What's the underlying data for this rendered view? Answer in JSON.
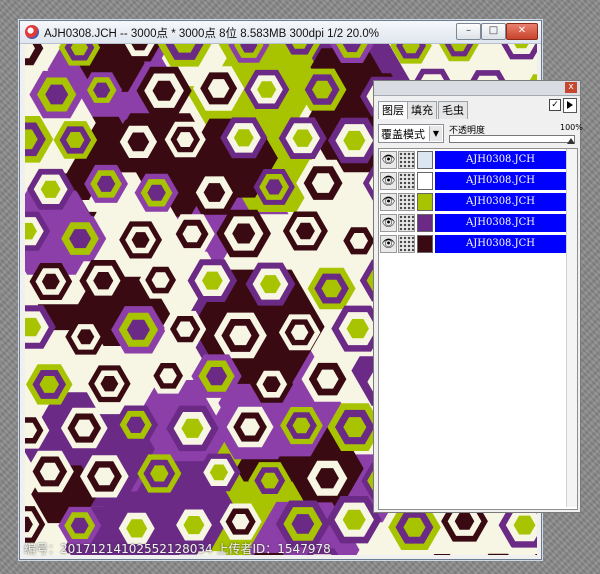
{
  "window": {
    "title": "AJH0308.JCH -- 3000点 * 3000点 8位   8.583MB 300dpi 1/2  20.0%",
    "controls": {
      "minimize": "–",
      "maximize": "□",
      "close": "✕"
    },
    "icon": "app-logo-icon"
  },
  "canvas": {
    "palette": {
      "purple": "#6b2a86",
      "lime": "#a8c400",
      "maroon": "#3a0a12",
      "cream": "#f7f6e4",
      "violet": "#8c3fa8"
    }
  },
  "layers_panel": {
    "close": "x",
    "tabs": [
      "图层",
      "填充",
      "毛虫"
    ],
    "checkbox": "✓",
    "blend_mode": "覆盖模式",
    "blend_arrow": "▼",
    "opacity_label": "不透明度",
    "opacity_value": "100%",
    "opacity": 1.0,
    "layers": [
      {
        "name": "AJH0308.JCH",
        "color": "#dce6f0",
        "eye": "👁"
      },
      {
        "name": "AJH0308.JCH",
        "color": "#ffffff",
        "eye": "👁"
      },
      {
        "name": "AJH0308.JCH",
        "color": "#a8c400",
        "eye": "👁"
      },
      {
        "name": "AJH0308.JCH",
        "color": "#6b2a86",
        "eye": "👁"
      },
      {
        "name": "AJH0308.JCH",
        "color": "#3a0a12",
        "eye": "👁"
      }
    ]
  },
  "watermark": "编号：20171214102552128034 上传者ID：1547978"
}
